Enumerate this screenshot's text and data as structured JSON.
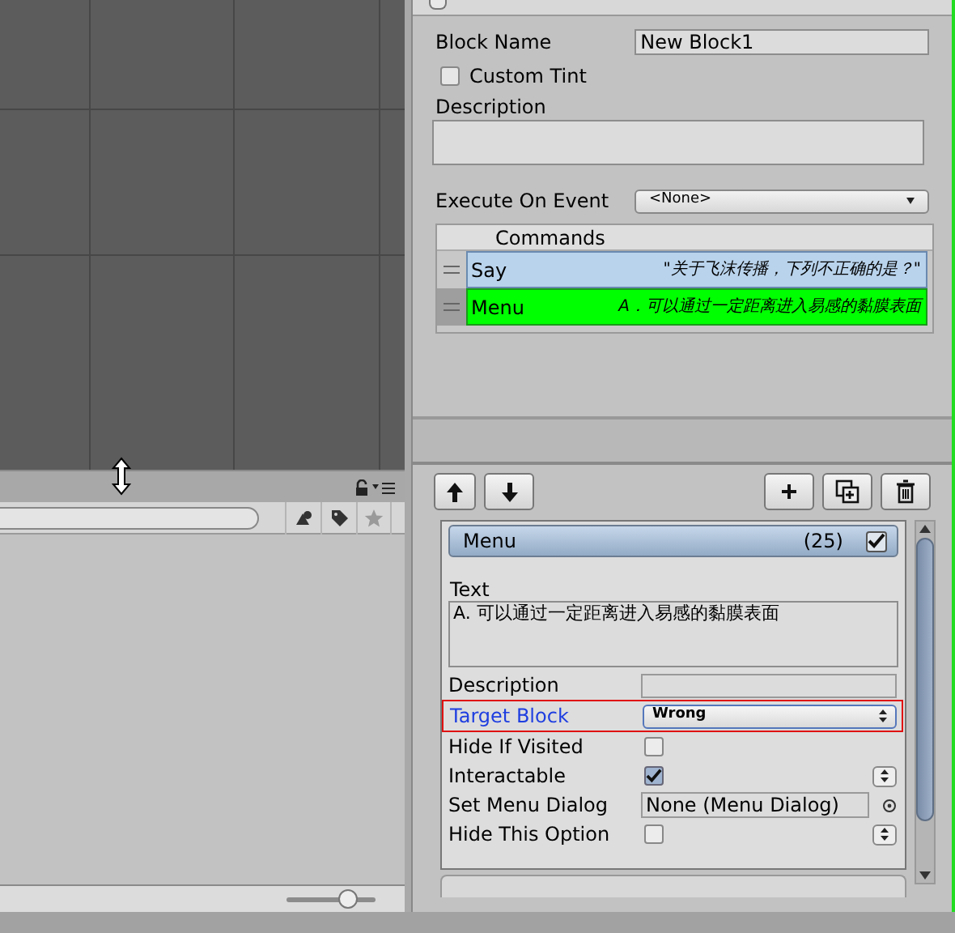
{
  "top_toggle": {
    "checked": false
  },
  "bottom_toolbar": {
    "slider": {
      "level": 0.72
    }
  },
  "block_inspector": {
    "block_name": {
      "label": "Block Name",
      "value": "New Block1"
    },
    "custom_tint": {
      "label": "Custom Tint",
      "checked": false
    },
    "description": {
      "label": "Description"
    },
    "execute_on_event": {
      "label": "Execute On Event",
      "value": "<None>"
    },
    "commands": {
      "header": "Commands",
      "rows": [
        {
          "name": "Say",
          "summary": "\"关于飞沫传播，下列不正确的是？\"",
          "selected": false,
          "color": "#b9d3ec"
        },
        {
          "name": "Menu",
          "summary": "A．可以通过一定距离进入易感的黏膜表面",
          "selected": true,
          "color": "#00ff00"
        }
      ]
    }
  },
  "command_inspector": {
    "title": "Menu",
    "count": "(25)",
    "enabled": true,
    "text": {
      "label": "Text",
      "value": "A. 可以通过一定距离进入易感的黏膜表面"
    },
    "properties": [
      {
        "kind": "field",
        "label": "Description",
        "highlighted": false
      },
      {
        "kind": "dropdown",
        "label": "Target Block",
        "value": "Wrong",
        "highlighted": true
      },
      {
        "kind": "checkbox",
        "label": "Hide If Visited",
        "checked": false,
        "options_button": false,
        "highlighted": false
      },
      {
        "kind": "checkbox",
        "label": "Interactable",
        "checked": true,
        "options_button": true,
        "highlighted": false
      },
      {
        "kind": "object",
        "label": "Set Menu Dialog",
        "value": "None (Menu Dialog)",
        "highlighted": false
      },
      {
        "kind": "checkbox",
        "label": "Hide This Option",
        "checked": false,
        "options_button": true,
        "highlighted": false
      }
    ]
  }
}
